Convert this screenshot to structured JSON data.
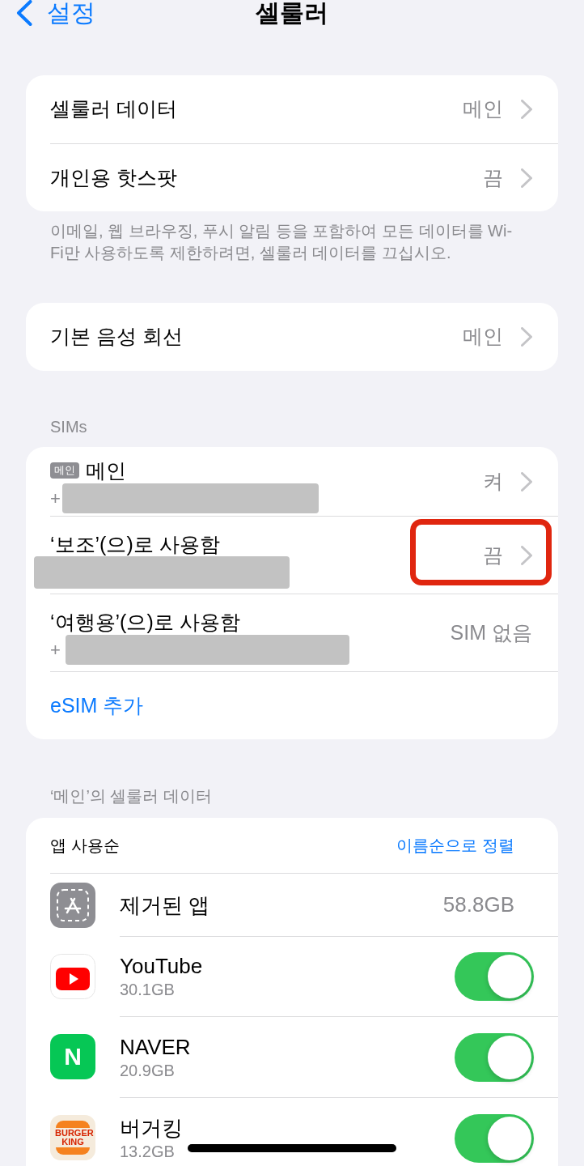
{
  "nav": {
    "back": "설정",
    "title": "셀룰러"
  },
  "general": {
    "rows": [
      {
        "label": "셀룰러 데이터",
        "value": "메인"
      },
      {
        "label": "개인용 핫스팟",
        "value": "끔"
      }
    ],
    "footer": "이메일, 웹 브라우징, 푸시 알림 등을 포함하여 모든 데이터를 Wi-Fi만 사용하도록 제한하려면, 셀룰러 데이터를 끄십시오."
  },
  "voice": {
    "rows": [
      {
        "label": "기본 음성 회선",
        "value": "메인"
      }
    ]
  },
  "sims": {
    "header": "SIMs",
    "rows": [
      {
        "kind": "sim",
        "tag": "메인",
        "label": "메인",
        "number": "+",
        "redacted": true,
        "value": "켜",
        "chevron": true,
        "highlighted": false
      },
      {
        "kind": "sim",
        "label": "‘보조’(으)로 사용함",
        "redacted": true,
        "value": "끔",
        "chevron": true,
        "highlighted": true
      },
      {
        "kind": "sim",
        "label": "‘여행용’(으)로 사용함",
        "number": "+",
        "redacted": true,
        "value": "SIM 없음",
        "chevron": false,
        "highlighted": false
      },
      {
        "kind": "action",
        "label": "eSIM 추가"
      }
    ]
  },
  "data": {
    "header": "‘메인’의 셀룰러 데이터",
    "sort_label": "앱 사용순",
    "sort_action": "이름순으로 정렬",
    "apps": [
      {
        "kind": "value",
        "name": "제거된 앱",
        "value": "58.8GB"
      },
      {
        "kind": "toggle",
        "name": "YouTube",
        "usage": "30.1GB",
        "on": true
      },
      {
        "kind": "toggle",
        "name": "NAVER",
        "usage": "20.9GB",
        "on": true,
        "logo_text": "N"
      },
      {
        "kind": "toggle",
        "name": "버거킹",
        "usage": "13.2GB",
        "on": true,
        "logo_text": "BURGER KING"
      }
    ]
  }
}
